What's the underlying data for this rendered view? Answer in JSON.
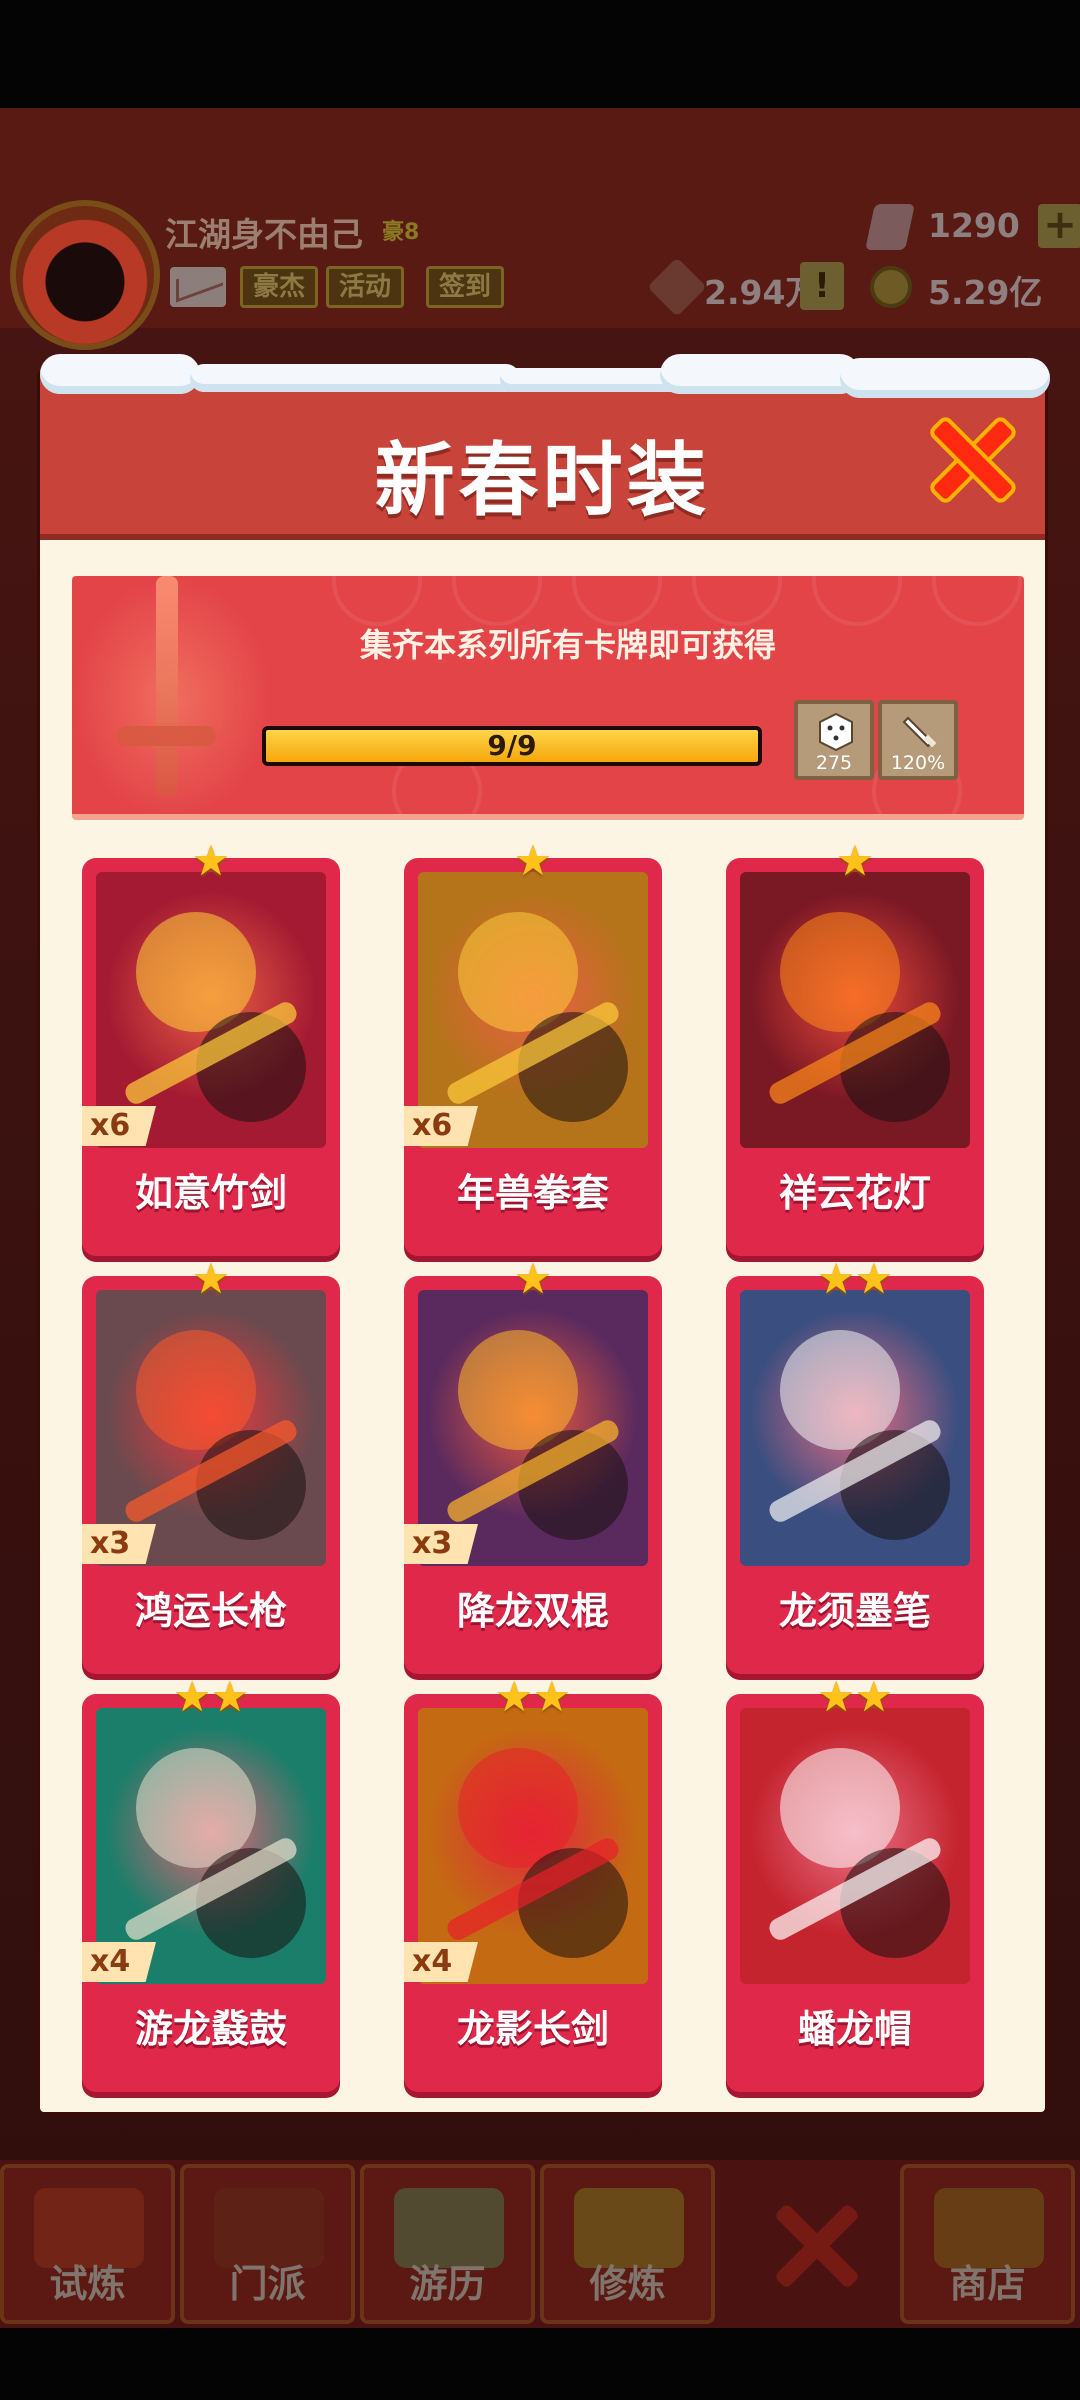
{
  "header": {
    "player_name": "江湖身不由己",
    "player_rank": "豪8",
    "buttons": [
      "豪杰",
      "活动",
      "签到"
    ],
    "gems": "1290",
    "gems_plus": "+",
    "token": "2.94万",
    "warning": "!",
    "coins": "5.29亿"
  },
  "modal": {
    "title": "新春时装",
    "banner": {
      "text": "集齐本系列所有卡牌即可获得",
      "progress_text": "9/9",
      "progress_fraction": 1.0,
      "rewards": [
        {
          "icon": "dice-icon",
          "value": "275"
        },
        {
          "icon": "sword-icon",
          "value": "120%"
        }
      ]
    },
    "cards": [
      {
        "name": "如意竹剑",
        "stars": 1,
        "count": "x6",
        "bg": "#a41a32",
        "accent": "#ffd23a"
      },
      {
        "name": "年兽拳套",
        "stars": 1,
        "count": "x6",
        "bg": "#b5741a",
        "accent": "#ffcd3a"
      },
      {
        "name": "祥云花灯",
        "stars": 1,
        "count": "",
        "bg": "#7a1824",
        "accent": "#ff8a1a"
      },
      {
        "name": "鸿运长枪",
        "stars": 1,
        "count": "x3",
        "bg": "#6a4a4e",
        "accent": "#ff5a2a"
      },
      {
        "name": "降龙双棍",
        "stars": 1,
        "count": "x3",
        "bg": "#5a2a5e",
        "accent": "#ffb82a"
      },
      {
        "name": "龙须墨笔",
        "stars": 2,
        "count": "",
        "bg": "#3a4e80",
        "accent": "#f4f4f4"
      },
      {
        "name": "游龙鼗鼓",
        "stars": 2,
        "count": "x4",
        "bg": "#1a7e6a",
        "accent": "#e8e2d0"
      },
      {
        "name": "龙影长剑",
        "stars": 2,
        "count": "x4",
        "bg": "#c46a12",
        "accent": "#e8202a"
      },
      {
        "name": "蟠龙帽",
        "stars": 2,
        "count": "",
        "bg": "#c4242e",
        "accent": "#ffffff"
      }
    ]
  },
  "tabs": [
    "试炼",
    "门派",
    "游历",
    "修炼",
    "商店"
  ]
}
